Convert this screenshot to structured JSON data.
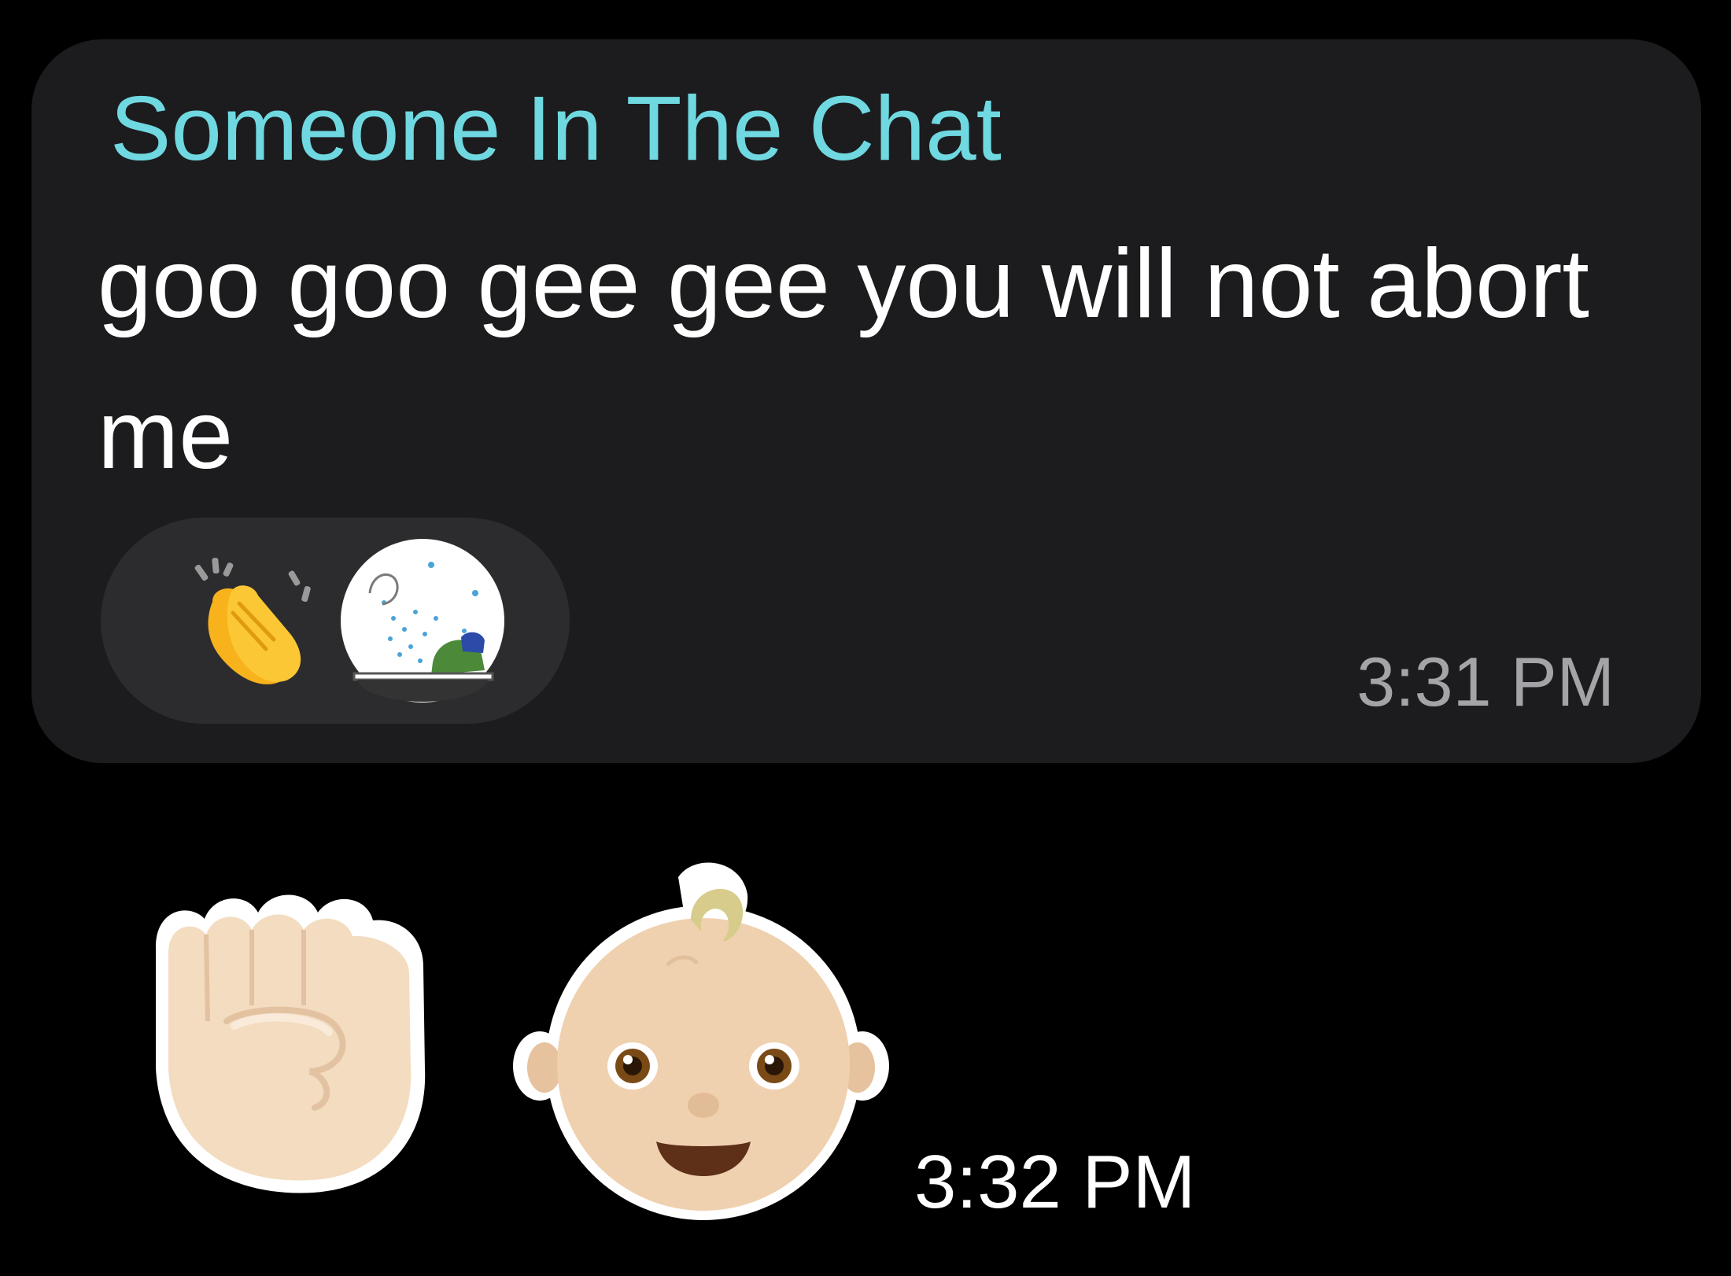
{
  "message": {
    "sender": "Someone In The Chat",
    "text": "goo goo gee gee you will not abort me",
    "time": "3:31 PM",
    "reactions": [
      {
        "icon": "clapping-hands-emoji"
      },
      {
        "icon": "frog-bath-sticker"
      }
    ]
  },
  "reply": {
    "emojis": [
      {
        "icon": "raised-fist-emoji"
      },
      {
        "icon": "baby-face-emoji"
      }
    ],
    "time": "3:32 PM"
  },
  "colors": {
    "background": "#000000",
    "bubble": "#1c1c1e",
    "reaction_pill": "#2c2c2e",
    "sender_name": "#6fd8e0",
    "message_text": "#ffffff",
    "timestamp": "#a4a4a8"
  }
}
